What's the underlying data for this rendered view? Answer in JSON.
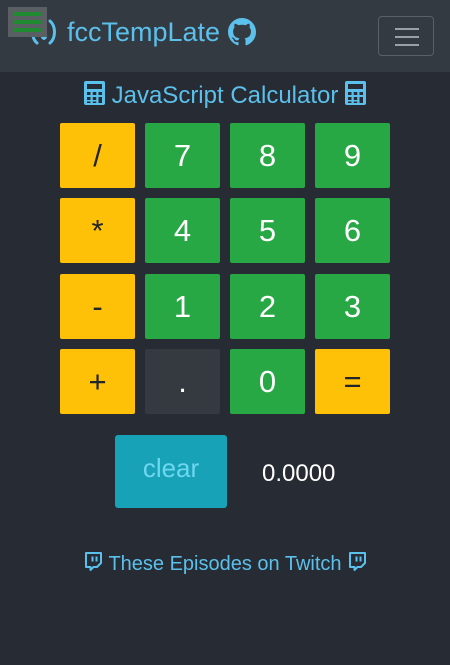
{
  "navbar": {
    "brand_label": "fccTempLate",
    "brand_color": "#5bc0eb",
    "background": "#343a42",
    "icons": [
      "freecodecamp-icon",
      "github-icon",
      "hamburger-menu-icon"
    ]
  },
  "calculator": {
    "title": "JavaScript Calculator",
    "title_icon": "calculator-icon",
    "keys": [
      {
        "label": "/",
        "kind": "operator"
      },
      {
        "label": "7",
        "kind": "number"
      },
      {
        "label": "8",
        "kind": "number"
      },
      {
        "label": "9",
        "kind": "number"
      },
      {
        "label": "*",
        "kind": "operator"
      },
      {
        "label": "4",
        "kind": "number"
      },
      {
        "label": "5",
        "kind": "number"
      },
      {
        "label": "6",
        "kind": "number"
      },
      {
        "label": "-",
        "kind": "operator"
      },
      {
        "label": "1",
        "kind": "number"
      },
      {
        "label": "2",
        "kind": "number"
      },
      {
        "label": "3",
        "kind": "number"
      },
      {
        "label": "+",
        "kind": "operator"
      },
      {
        "label": ".",
        "kind": "decimal"
      },
      {
        "label": "0",
        "kind": "number"
      },
      {
        "label": "=",
        "kind": "equals"
      }
    ],
    "clear_label": "clear",
    "display_value": "0.0000",
    "colors": {
      "operator": "#ffc107",
      "number": "#28a745",
      "decimal": "#343a40",
      "clear": "#17a2b8"
    }
  },
  "footer": {
    "link_label": "These Episodes on Twitch",
    "icon": "twitch-icon"
  }
}
